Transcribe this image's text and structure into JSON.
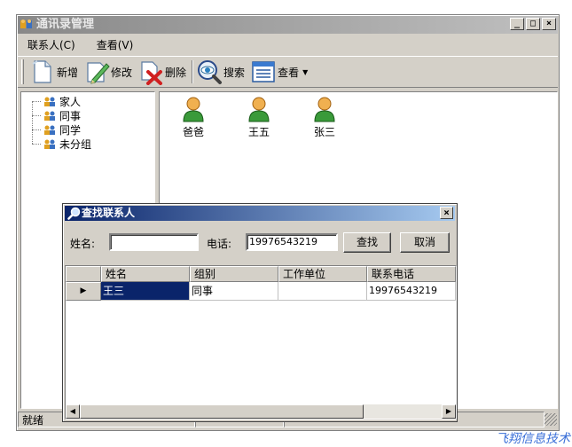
{
  "window": {
    "title": "通讯录管理"
  },
  "menu": [
    {
      "label": "联系人(C)"
    },
    {
      "label": "查看(V)"
    }
  ],
  "toolbar": {
    "add": "新增",
    "edit": "修改",
    "delete": "删除",
    "search": "搜索",
    "view": "查看"
  },
  "tree": [
    {
      "label": "家人"
    },
    {
      "label": "同事"
    },
    {
      "label": "同学"
    },
    {
      "label": "未分组"
    }
  ],
  "contacts": [
    {
      "name": "爸爸"
    },
    {
      "name": "王五"
    },
    {
      "name": "张三"
    }
  ],
  "status": {
    "ready": "就绪"
  },
  "dialog": {
    "title": "查找联系人",
    "name_label": "姓名:",
    "name_value": "",
    "phone_label": "电话:",
    "phone_value": "19976543219",
    "find_button": "查找",
    "cancel_button": "取消",
    "columns": [
      "姓名",
      "组别",
      "工作单位",
      "联系电话"
    ],
    "rows": [
      {
        "name": "王三",
        "group": "同事",
        "company": "",
        "phone": "19976543219"
      }
    ]
  },
  "watermark": "飞翔信息技术",
  "colors": {
    "dialog_title_start": "#0a246a",
    "dialog_title_end": "#a6caf0",
    "selection": "#0a246a",
    "watermark": "#3a6fd8"
  },
  "icons": [
    "app-icon",
    "new-document-icon",
    "edit-pencil-icon",
    "delete-x-icon",
    "search-eye-icon",
    "view-list-icon",
    "group-icon",
    "contact-person-icon",
    "magnifier-icon"
  ]
}
